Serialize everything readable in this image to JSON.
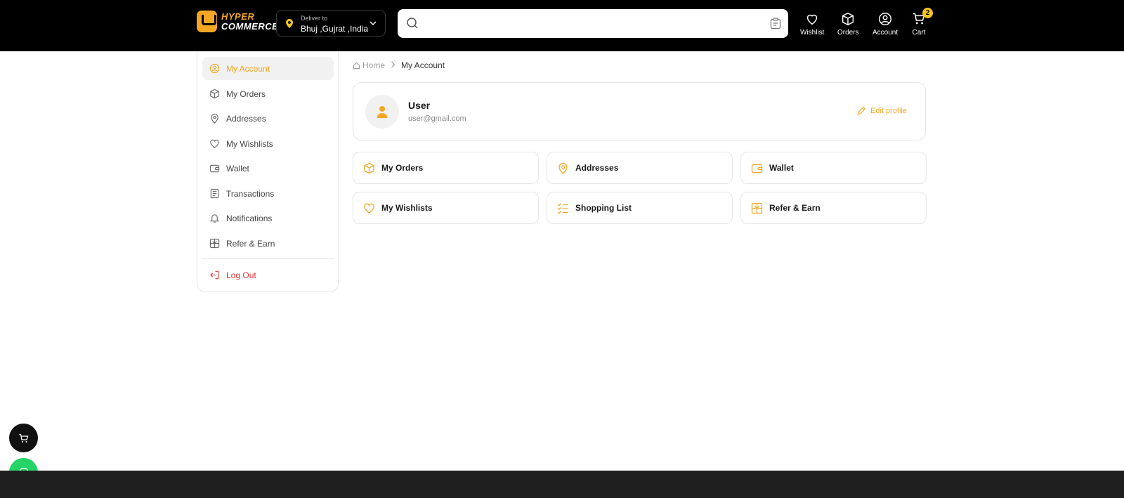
{
  "header": {
    "logo": {
      "line1": "HYPER",
      "line2": "COMMERCE"
    },
    "deliver": {
      "label": "Deliver to",
      "location": "Bhuj ,Gujrat ,India"
    },
    "search": {
      "placeholder": "",
      "value": ""
    },
    "nav": [
      {
        "label": "Wishlist",
        "icon": "heart-icon"
      },
      {
        "label": "Orders",
        "icon": "box-icon"
      },
      {
        "label": "Account",
        "icon": "user-circle-icon"
      },
      {
        "label": "Cart",
        "icon": "cart-icon",
        "badge": "2"
      }
    ]
  },
  "sidebar": {
    "items": [
      {
        "label": "My Account",
        "icon": "user-circle-icon",
        "active": true
      },
      {
        "label": "My Orders",
        "icon": "box-icon"
      },
      {
        "label": "Addresses",
        "icon": "location-pin-icon"
      },
      {
        "label": "My Wishlists",
        "icon": "heart-icon"
      },
      {
        "label": "Wallet",
        "icon": "wallet-icon"
      },
      {
        "label": "Transactions",
        "icon": "receipt-icon"
      },
      {
        "label": "Notifications",
        "icon": "bell-icon"
      },
      {
        "label": "Refer & Earn",
        "icon": "gift-icon"
      }
    ],
    "logout": {
      "label": "Log Out",
      "icon": "logout-icon"
    }
  },
  "breadcrumb": {
    "home": "Home",
    "current": "My Account"
  },
  "profile": {
    "name": "User",
    "email": "user@gmail.com",
    "edit_label": "Edit profile"
  },
  "cards": [
    {
      "label": "My Orders",
      "icon": "box-icon"
    },
    {
      "label": "Addresses",
      "icon": "location-pin-icon"
    },
    {
      "label": "Wallet",
      "icon": "wallet-icon"
    },
    {
      "label": "My Wishlists",
      "icon": "heart-icon"
    },
    {
      "label": "Shopping List",
      "icon": "checklist-icon"
    },
    {
      "label": "Refer & Earn",
      "icon": "gift-icon"
    }
  ],
  "colors": {
    "accent": "#f5a623",
    "header_bg": "#000000",
    "danger": "#e53935",
    "whatsapp": "#25d366"
  }
}
